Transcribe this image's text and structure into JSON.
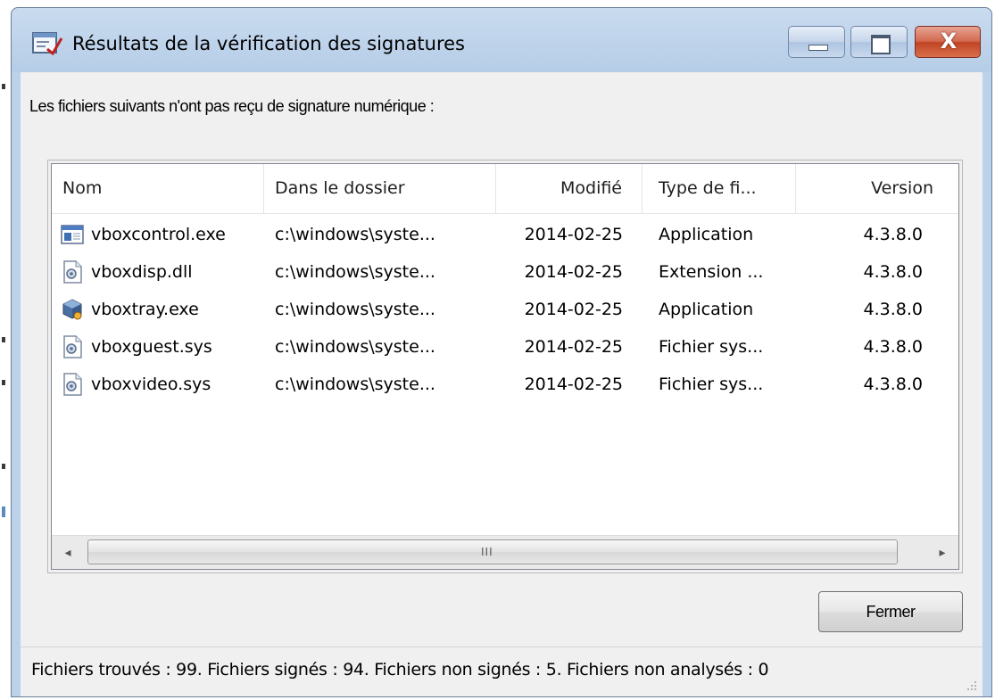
{
  "window": {
    "title": "Résultats de la vérification des signatures",
    "icon": "signature-check-icon",
    "controls": {
      "minimize": "minimize-icon",
      "maximize": "maximize-icon",
      "close_glyph": "X"
    }
  },
  "message": "Les fichiers suivants n'ont pas reçu de signature numérique :",
  "list": {
    "columns": [
      "Nom",
      "Dans le dossier",
      "Modifié",
      "Type de fi...",
      "Version"
    ],
    "rows": [
      {
        "icon": "application-window-icon",
        "name": "vboxcontrol.exe",
        "folder": "c:\\windows\\syste...",
        "modified": "2014-02-25",
        "type": "Application",
        "version": "4.3.8.0"
      },
      {
        "icon": "system-file-icon",
        "name": "vboxdisp.dll",
        "folder": "c:\\windows\\syste...",
        "modified": "2014-02-25",
        "type": "Extension ...",
        "version": "4.3.8.0"
      },
      {
        "icon": "virtualbox-cube-icon",
        "name": "vboxtray.exe",
        "folder": "c:\\windows\\syste...",
        "modified": "2014-02-25",
        "type": "Application",
        "version": "4.3.8.0"
      },
      {
        "icon": "system-file-icon",
        "name": "vboxguest.sys",
        "folder": "c:\\windows\\syste...",
        "modified": "2014-02-25",
        "type": "Fichier sys...",
        "version": "4.3.8.0"
      },
      {
        "icon": "system-file-icon",
        "name": "vboxvideo.sys",
        "folder": "c:\\windows\\syste...",
        "modified": "2014-02-25",
        "type": "Fichier sys...",
        "version": "4.3.8.0"
      }
    ],
    "scrollbar": {
      "left_arrow": "◂",
      "right_arrow": "▸",
      "grip": "III"
    }
  },
  "buttons": {
    "close": "Fermer"
  },
  "status": "Fichiers trouvés : 99. Fichiers signés : 94. Fichiers non signés : 5.  Fichiers non analysés : 0",
  "colors": {
    "title_bar": "#bcd2ea",
    "close_button": "#c9492a",
    "client_background": "#f0f0f0"
  }
}
